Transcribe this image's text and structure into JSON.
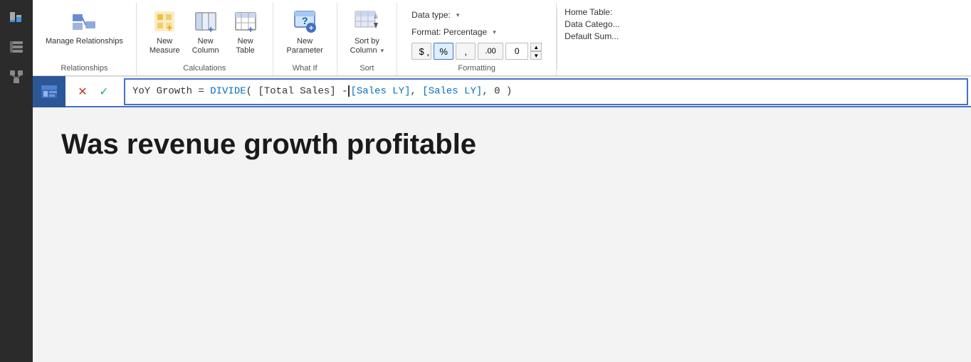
{
  "sidebar": {
    "icons": [
      {
        "name": "report-icon",
        "label": "Report"
      },
      {
        "name": "data-icon",
        "label": "Data"
      },
      {
        "name": "model-icon",
        "label": "Model"
      }
    ]
  },
  "ribbon": {
    "groups": [
      {
        "name": "relationships",
        "label": "Relationships",
        "buttons": [
          {
            "name": "manage-relationships-btn",
            "label": "Manage\nRelationships"
          }
        ]
      },
      {
        "name": "calculations",
        "label": "Calculations",
        "buttons": [
          {
            "name": "new-measure-btn",
            "label": "New\nMeasure"
          },
          {
            "name": "new-column-btn",
            "label": "New\nColumn"
          },
          {
            "name": "new-table-btn",
            "label": "New\nTable"
          }
        ]
      },
      {
        "name": "whatif",
        "label": "What If",
        "buttons": [
          {
            "name": "new-parameter-btn",
            "label": "New\nParameter"
          }
        ]
      },
      {
        "name": "sort",
        "label": "Sort",
        "buttons": [
          {
            "name": "sort-by-column-btn",
            "label": "Sort by\nColumn"
          }
        ]
      },
      {
        "name": "formatting",
        "label": "Formatting",
        "datatype_label": "Data type:",
        "format_label": "Format: Percentage",
        "currency_symbol": "$",
        "percent_symbol": "%",
        "comma_symbol": ",",
        "decimal_symbol": ".00",
        "decimal_value": "0"
      },
      {
        "name": "hometable",
        "label": "",
        "hometable_label": "Home Table:",
        "datacategory_label": "Data Catego...",
        "defaultsum_label": "Default Sum..."
      }
    ]
  },
  "formula_bar": {
    "formula_text_part1": "YoY Growth = DIVIDE( [Total Sales] -",
    "formula_text_part2": "[Sales LY], [Sales LY], 0 )",
    "cancel_label": "✕",
    "confirm_label": "✓"
  },
  "canvas": {
    "title": "Was revenue growth profitable"
  }
}
